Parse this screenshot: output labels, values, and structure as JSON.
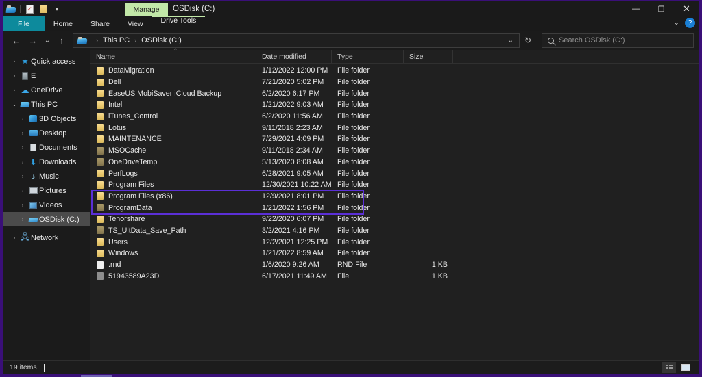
{
  "titlebar": {
    "quick_access": [
      {
        "name": "explorer-icon",
        "label": ""
      },
      {
        "name": "properties-icon",
        "label": ""
      },
      {
        "name": "new-folder-icon",
        "label": ""
      },
      {
        "name": "customize-caret-icon",
        "label": "▾"
      }
    ],
    "manage_label": "Manage",
    "window_title": "OSDisk (C:)",
    "minimize": "—",
    "maximize": "❐",
    "close": "✕"
  },
  "ribbon": {
    "tabs": [
      {
        "label": "File",
        "active": true
      },
      {
        "label": "Home",
        "active": false
      },
      {
        "label": "Share",
        "active": false
      },
      {
        "label": "View",
        "active": false
      },
      {
        "label": "Drive Tools",
        "active": false
      }
    ],
    "collapse_caret": "⌄",
    "help_label": "?"
  },
  "address": {
    "back": "←",
    "forward": "→",
    "recent": "⌄",
    "up": "↑",
    "breadcrumbs": [
      "This PC",
      "OSDisk (C:)"
    ],
    "separator": "›",
    "dropdown": "⌄",
    "refresh": "↻"
  },
  "search": {
    "placeholder": "Search OSDisk (C:)",
    "value": ""
  },
  "sidebar": {
    "items": [
      {
        "label": "Quick access",
        "icon": "star-icon",
        "indent": 0,
        "chevron": "›",
        "expanded": false,
        "selected": false
      },
      {
        "label": "E",
        "icon": "drive-icon",
        "indent": 0,
        "chevron": "›",
        "expanded": false,
        "selected": false
      },
      {
        "label": "OneDrive",
        "icon": "cloud-icon",
        "indent": 0,
        "chevron": "›",
        "expanded": false,
        "selected": false
      },
      {
        "label": "This PC",
        "icon": "pc-icon",
        "indent": 0,
        "chevron": "⌄",
        "expanded": true,
        "selected": false
      },
      {
        "label": "3D Objects",
        "icon": "3d-objects-icon",
        "indent": 1,
        "chevron": "›",
        "expanded": false,
        "selected": false
      },
      {
        "label": "Desktop",
        "icon": "desktop-icon",
        "indent": 1,
        "chevron": "›",
        "expanded": false,
        "selected": false
      },
      {
        "label": "Documents",
        "icon": "documents-icon",
        "indent": 1,
        "chevron": "›",
        "expanded": false,
        "selected": false
      },
      {
        "label": "Downloads",
        "icon": "downloads-icon",
        "indent": 1,
        "chevron": "›",
        "expanded": false,
        "selected": false
      },
      {
        "label": "Music",
        "icon": "music-icon",
        "indent": 1,
        "chevron": "›",
        "expanded": false,
        "selected": false
      },
      {
        "label": "Pictures",
        "icon": "pictures-icon",
        "indent": 1,
        "chevron": "›",
        "expanded": false,
        "selected": false
      },
      {
        "label": "Videos",
        "icon": "videos-icon",
        "indent": 1,
        "chevron": "›",
        "expanded": false,
        "selected": false
      },
      {
        "label": "OSDisk (C:)",
        "icon": "osdisk-icon",
        "indent": 1,
        "chevron": "›",
        "expanded": false,
        "selected": true
      },
      {
        "label": "Network",
        "icon": "network-icon",
        "indent": 0,
        "chevron": "›",
        "expanded": false,
        "selected": false
      }
    ]
  },
  "filelist": {
    "columns": [
      "Name",
      "Date modified",
      "Type",
      "Size"
    ],
    "sort_column": "Name",
    "sort_direction": "ascending",
    "highlight": {
      "from_row": 11,
      "to_row": 12,
      "color": "#5b2fd6"
    },
    "rows": [
      {
        "name": "DataMigration",
        "date": "1/12/2022 12:00 PM",
        "type": "File folder",
        "size": "",
        "icon": "folder-icon"
      },
      {
        "name": "Dell",
        "date": "7/21/2020 5:02 PM",
        "type": "File folder",
        "size": "",
        "icon": "folder-icon"
      },
      {
        "name": "EaseUS MobiSaver iCloud Backup",
        "date": "6/2/2020 6:17 PM",
        "type": "File folder",
        "size": "",
        "icon": "folder-icon"
      },
      {
        "name": "Intel",
        "date": "1/21/2022 9:03 AM",
        "type": "File folder",
        "size": "",
        "icon": "folder-icon"
      },
      {
        "name": "iTunes_Control",
        "date": "6/2/2020 11:56 AM",
        "type": "File folder",
        "size": "",
        "icon": "folder-icon"
      },
      {
        "name": "Lotus",
        "date": "9/11/2018 2:23 AM",
        "type": "File folder",
        "size": "",
        "icon": "folder-icon"
      },
      {
        "name": "MAINTENANCE",
        "date": "7/29/2021 4:09 PM",
        "type": "File folder",
        "size": "",
        "icon": "folder-icon"
      },
      {
        "name": "MSOCache",
        "date": "9/11/2018 2:34 AM",
        "type": "File folder",
        "size": "",
        "icon": "folder-hidden-icon"
      },
      {
        "name": "OneDriveTemp",
        "date": "5/13/2020 8:08 AM",
        "type": "File folder",
        "size": "",
        "icon": "folder-hidden-icon"
      },
      {
        "name": "PerfLogs",
        "date": "6/28/2021 9:05 AM",
        "type": "File folder",
        "size": "",
        "icon": "folder-icon"
      },
      {
        "name": "Program Files",
        "date": "12/30/2021 10:22 AM",
        "type": "File folder",
        "size": "",
        "icon": "folder-icon"
      },
      {
        "name": "Program Files (x86)",
        "date": "12/9/2021 8:01 PM",
        "type": "File folder",
        "size": "",
        "icon": "folder-icon"
      },
      {
        "name": "ProgramData",
        "date": "1/21/2022 1:56 PM",
        "type": "File folder",
        "size": "",
        "icon": "folder-hidden-icon"
      },
      {
        "name": "Tenorshare",
        "date": "9/22/2020 6:07 PM",
        "type": "File folder",
        "size": "",
        "icon": "folder-icon"
      },
      {
        "name": "TS_UltData_Save_Path",
        "date": "3/2/2021 4:16 PM",
        "type": "File folder",
        "size": "",
        "icon": "folder-hidden-icon"
      },
      {
        "name": "Users",
        "date": "12/2/2021 12:25 PM",
        "type": "File folder",
        "size": "",
        "icon": "folder-icon"
      },
      {
        "name": "Windows",
        "date": "1/21/2022 8:59 AM",
        "type": "File folder",
        "size": "",
        "icon": "folder-icon"
      },
      {
        "name": ".rnd",
        "date": "1/6/2020 9:26 AM",
        "type": "RND File",
        "size": "1 KB",
        "icon": "file-icon"
      },
      {
        "name": "51943589A23D",
        "date": "6/17/2021 11:49 AM",
        "type": "File",
        "size": "1 KB",
        "icon": "file-generic-icon"
      }
    ]
  },
  "statusbar": {
    "item_count": "19 items",
    "view_details": "details-view",
    "view_tiles": "tiles-view"
  },
  "colors": {
    "accent_file_tab": "#0d8a9c",
    "manage_header": "#c2e8a8",
    "highlight_box": "#5b2fd6",
    "desktop_background": "#3a0f78",
    "window_background": "#1b1b1b",
    "list_background": "#202020"
  }
}
